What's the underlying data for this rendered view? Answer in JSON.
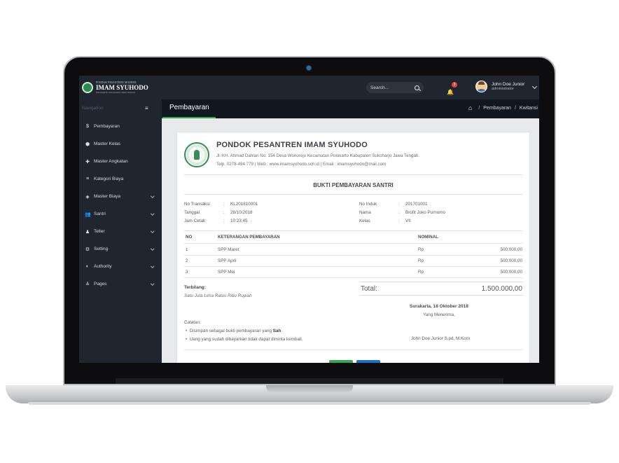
{
  "app": {
    "brand_small": "PONDOK PESANTREN MODERN",
    "brand_name": "IMAM SYUHODO",
    "brand_sub": "POLOKARTO SUKOHARJO JAWA TENGAH"
  },
  "header": {
    "search_placeholder": "Search...",
    "notifications_count": "3",
    "user_name": "John Doe Junior",
    "user_role": "administrator"
  },
  "sidebar": {
    "caption": "Navigation",
    "items": [
      {
        "label": "Pembayaran",
        "icon": "dollar-icon",
        "glyph": "$"
      },
      {
        "label": "Master Kelas",
        "icon": "cube-icon",
        "glyph": "⬢"
      },
      {
        "label": "Master Angkatan",
        "icon": "pin-icon",
        "glyph": "✚"
      },
      {
        "label": "Kategori Biaya",
        "icon": "list-icon",
        "glyph": "≡"
      },
      {
        "label": "Master Biaya",
        "icon": "diamond-icon",
        "glyph": "◈"
      },
      {
        "label": "Santri",
        "icon": "users-icon",
        "glyph": "👥"
      },
      {
        "label": "Teller",
        "icon": "user-icon",
        "glyph": "♟"
      },
      {
        "label": "Setting",
        "icon": "gear-icon",
        "glyph": "⚙"
      },
      {
        "label": "Authority",
        "icon": "shield-icon",
        "glyph": "◐"
      },
      {
        "label": "Pages",
        "icon": "pages-icon",
        "glyph": "≜"
      }
    ]
  },
  "page": {
    "menu_glyph": "≡",
    "title": "Pembayaran",
    "breadcrumb": [
      "Pembayaran",
      "Kwitansi"
    ]
  },
  "receipt": {
    "org_name": "PONDOK PESANTREN IMAM SYUHODO",
    "address": "Jl. KH. Ahmad Dahlan No. 154 Desa Wonorejo Kecamatan Polokarto Kabupaten Sukoharjo Jawa Tengah.",
    "contact": "Telp. 0278-494 779 | Web : www.imamsyuhodo.sch.id | Email : imamsyuhodo@mail.com",
    "title": "BUKTI PEMBAYARAN SANTRI",
    "left_info": [
      {
        "key": "No Transaksi",
        "value": "KL201810001"
      },
      {
        "key": "Tanggal",
        "value": "28/10/2018"
      },
      {
        "key": "Jam Cetak",
        "value": "10:23:45"
      }
    ],
    "right_info": [
      {
        "key": "No Induk",
        "value": "201701001"
      },
      {
        "key": "Nama",
        "value": "Brofit Joko Purnomo"
      },
      {
        "key": "Kelas",
        "value": "VII"
      }
    ],
    "table": {
      "headers": [
        "NO",
        "KETERANGAN PEMBAYARAN",
        "NOMINAL"
      ],
      "rows": [
        {
          "no": "1",
          "desc": "SPP Maret",
          "cur": "Rp",
          "amount": "500.000,00"
        },
        {
          "no": "2",
          "desc": "SPP April",
          "cur": "Rp",
          "amount": "500.000,00"
        },
        {
          "no": "3",
          "desc": "SPP Mei",
          "cur": "Rp",
          "amount": "500.000,00"
        }
      ]
    },
    "terbilang_label": "Terbilang:",
    "terbilang_value": "Satu Juta Lima Ratus Ribu Rupiah",
    "total_label": "Total:",
    "total_value": "1.500.000,00",
    "sign_place": "Surakarta, 18 Oktober 2018",
    "sign_role": "Yang Menerima,",
    "sign_name": "John Doe Junior S.pd, M.Kom",
    "notes_label": "Catatan:",
    "note1_prefix": "Disimpan sebagai bukti pembayaran yang ",
    "note1_bold": "Sah",
    "note1_suffix": ".",
    "note2": "Uang yang sudah dibayarkan tidak dapat diminta kembali."
  }
}
